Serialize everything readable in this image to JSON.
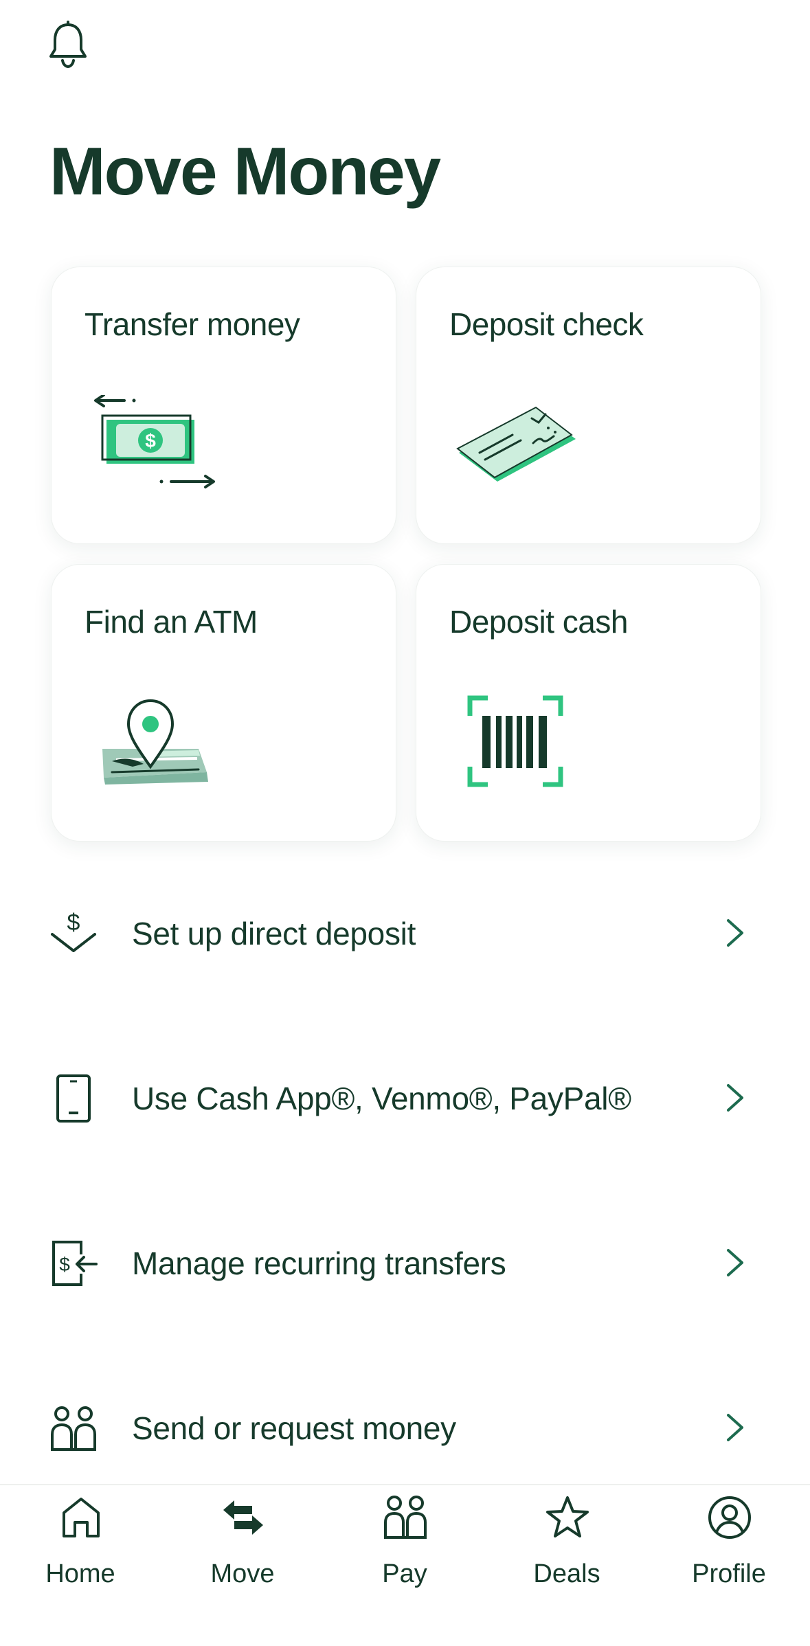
{
  "header": {
    "bell_icon": "bell-icon",
    "title": "Move Money"
  },
  "cards": [
    {
      "label": "Transfer money",
      "icon": "transfer-money-illustration"
    },
    {
      "label": "Deposit check",
      "icon": "check-illustration"
    },
    {
      "label": "Find an ATM",
      "icon": "map-pin-illustration"
    },
    {
      "label": "Deposit cash",
      "icon": "barcode-illustration"
    }
  ],
  "list": [
    {
      "label": "Set up direct deposit",
      "icon": "direct-deposit-icon"
    },
    {
      "label": "Use Cash App®, Venmo®, PayPal®",
      "icon": "phone-icon"
    },
    {
      "label": "Manage recurring transfers",
      "icon": "recurring-transfer-icon"
    },
    {
      "label": "Send or request money",
      "icon": "people-icon"
    }
  ],
  "tabs": [
    {
      "label": "Home",
      "icon": "home-icon"
    },
    {
      "label": "Move",
      "icon": "move-arrows-icon"
    },
    {
      "label": "Pay",
      "icon": "pay-people-icon"
    },
    {
      "label": "Deals",
      "icon": "star-icon"
    },
    {
      "label": "Profile",
      "icon": "profile-icon"
    }
  ],
  "colors": {
    "primary_text": "#163a2b",
    "accent_green": "#2fc480",
    "light_green": "#cdeedd",
    "chevron": "#1d6b4f"
  }
}
